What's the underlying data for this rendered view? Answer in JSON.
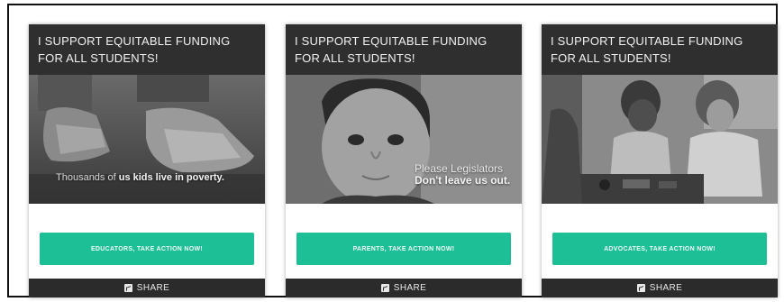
{
  "cards": [
    {
      "headline": "I SUPPORT EQUITABLE FUNDING FOR ALL STUDENTS!",
      "overlay_light": "Thousands of ",
      "overlay_bold": "us kids live in poverty.",
      "cta_label": "EDUCATORS, TAKE ACTION NOW!",
      "share_label": "SHARE"
    },
    {
      "headline": "I SUPPORT EQUITABLE FUNDING FOR ALL STUDENTS!",
      "overlay_line1": "Please Legislators",
      "overlay_line2": "Don't leave us out.",
      "cta_label": "PARENTS, TAKE ACTION NOW!",
      "share_label": "SHARE"
    },
    {
      "headline": "I SUPPORT EQUITABLE FUNDING FOR ALL STUDENTS!",
      "cta_label": "ADVOCATES, TAKE ACTION NOW!",
      "share_label": "SHARE"
    }
  ],
  "colors": {
    "cta": "#1dbf96",
    "header": "#2f2f2f",
    "share_bar": "#2b2b2b"
  },
  "icons": {
    "share": "share-square-icon"
  }
}
